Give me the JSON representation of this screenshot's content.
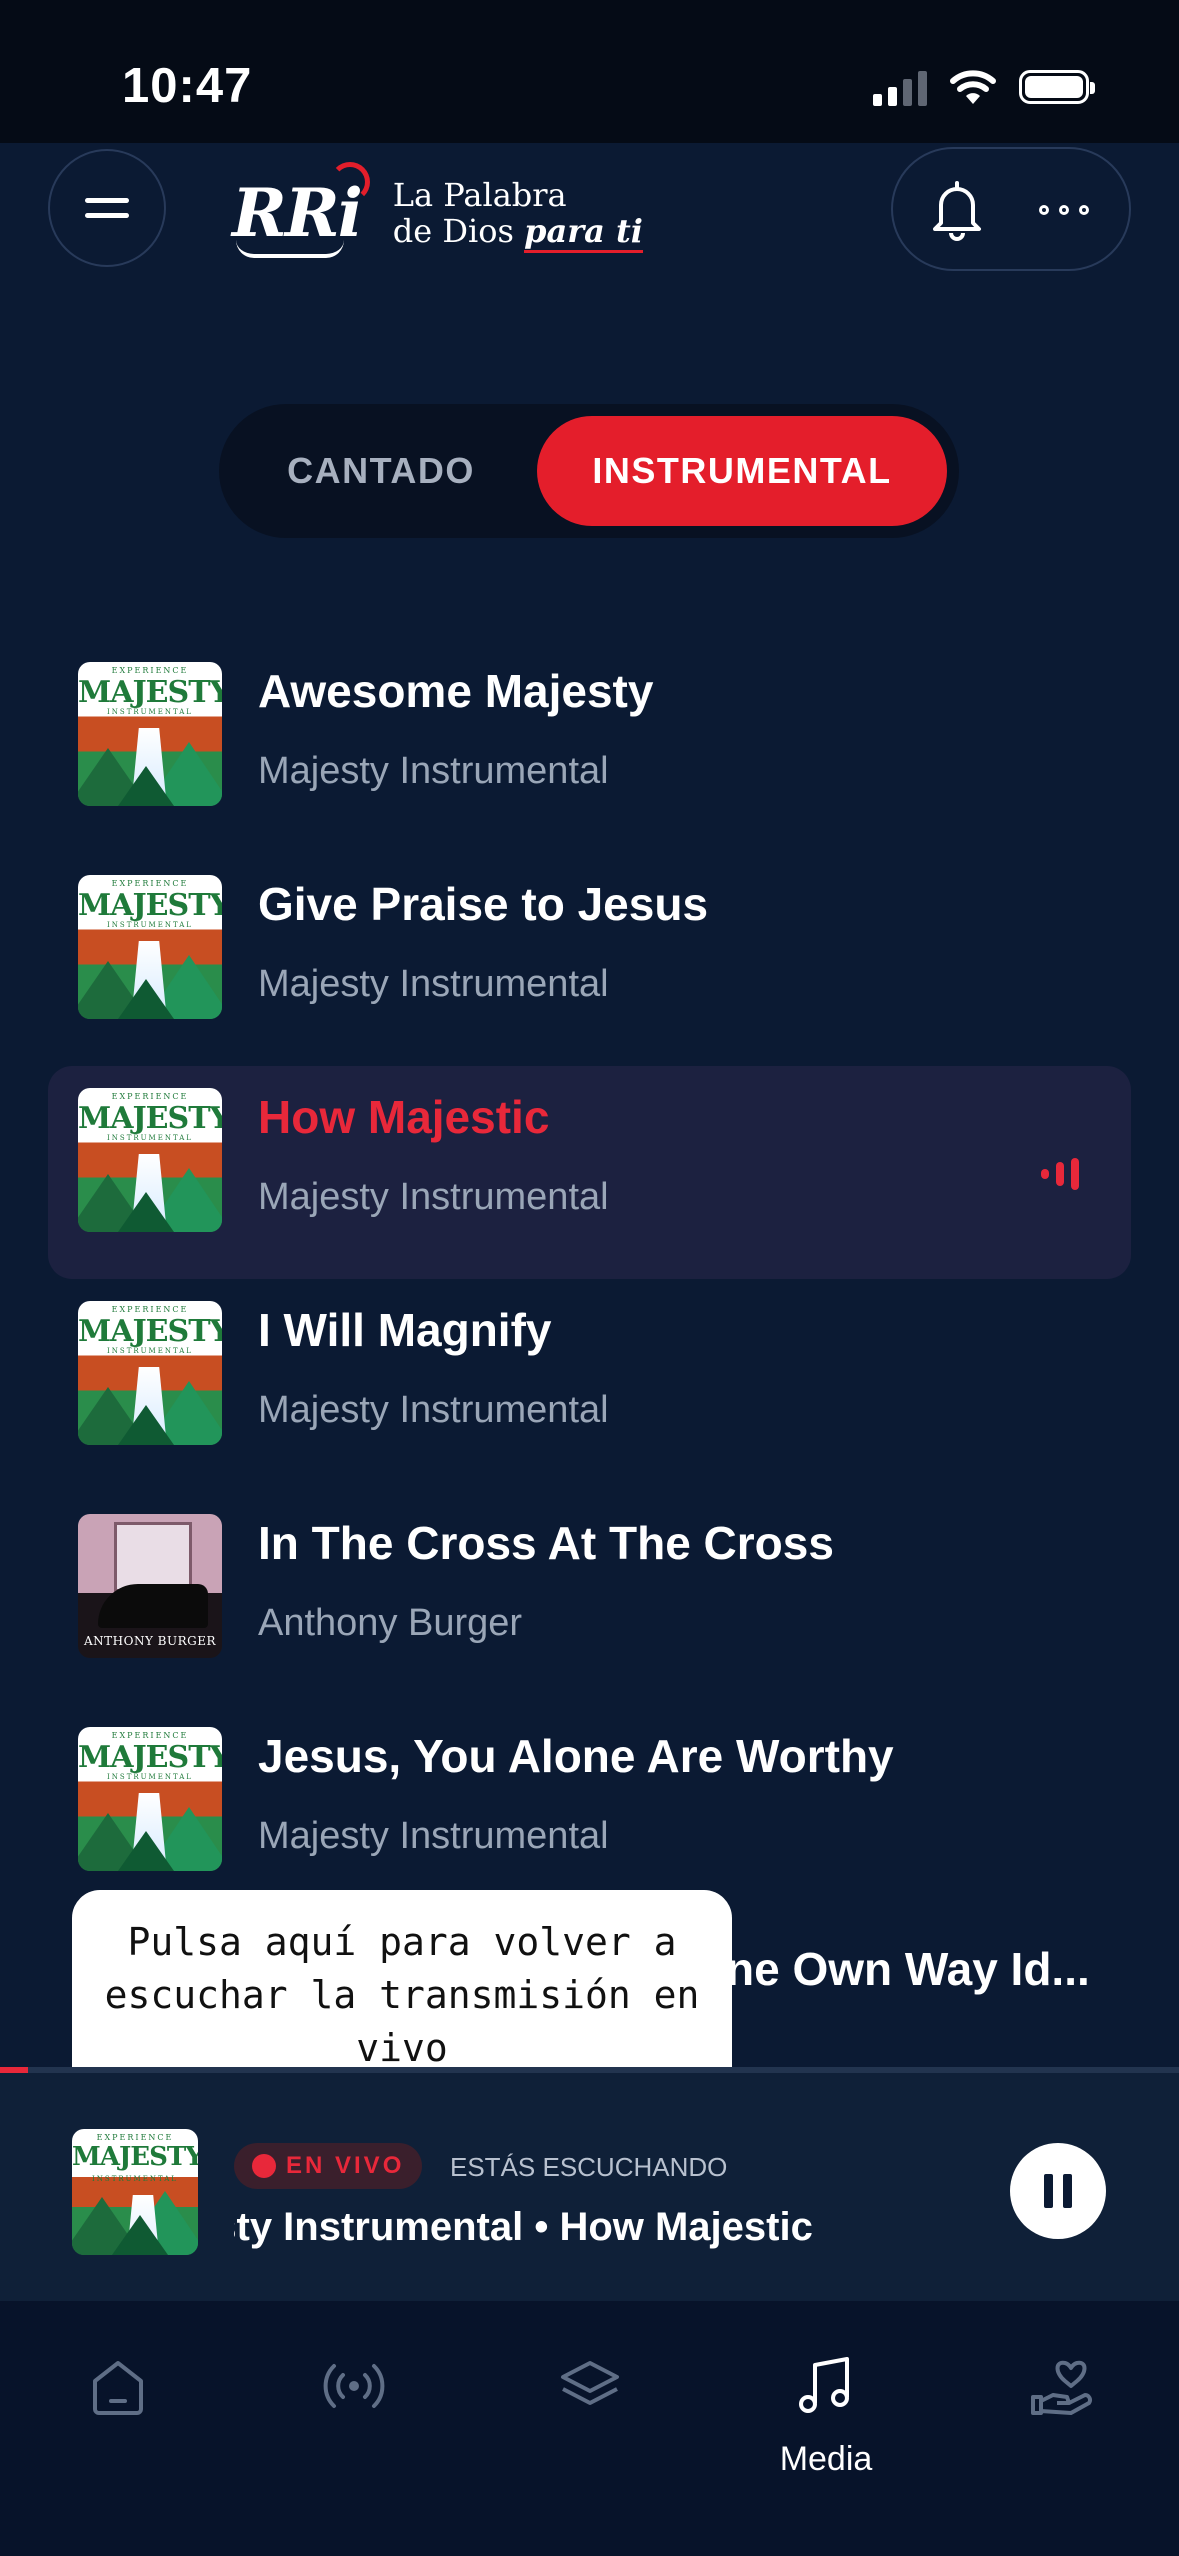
{
  "status_bar": {
    "time": "10:47"
  },
  "header": {
    "logo_mark": "RRi",
    "tagline_line1": "La Palabra",
    "tagline_line2_prefix": "de Dios ",
    "tagline_line2_emphasis": "para ti"
  },
  "segment": {
    "options": [
      {
        "label": "CANTADO",
        "selected": false
      },
      {
        "label": "INSTRUMENTAL",
        "selected": true
      }
    ]
  },
  "tracks": [
    {
      "title": "Awesome Majesty",
      "artist": "Majesty Instrumental",
      "art": "majesty",
      "playing": false
    },
    {
      "title": "Give Praise to Jesus",
      "artist": "Majesty Instrumental",
      "art": "majesty",
      "playing": false
    },
    {
      "title": "How Majestic",
      "artist": "Majesty Instrumental",
      "art": "majesty",
      "playing": true
    },
    {
      "title": "I Will Magnify",
      "artist": "Majesty Instrumental",
      "art": "majesty",
      "playing": false
    },
    {
      "title": "In The Cross At The Cross",
      "artist": "Anthony Burger",
      "art": "burger",
      "playing": false
    },
    {
      "title": "Jesus, You Alone Are Worthy",
      "artist": "Majesty Instrumental",
      "art": "majesty",
      "playing": false
    },
    {
      "title": "ne Own Way Id...",
      "artist": "",
      "art": "none",
      "playing": false
    }
  ],
  "album_art": {
    "majesty": {
      "top": "EXPERIENCE",
      "main": "MAJESTY",
      "sub": "INSTRUMENTAL"
    },
    "burger": {
      "name": "ANTHONY BURGER"
    }
  },
  "tooltip": {
    "text": "Pulsa aquí para volver a escuchar la transmisión en vivo"
  },
  "mini_player": {
    "live_label": "EN VIVO",
    "listening_label": "ESTÁS ESCUCHANDO",
    "now_playing": "esty Instrumental • How Majestic"
  },
  "bottom_nav": {
    "items": [
      {
        "icon": "home-icon",
        "label": "",
        "active": false
      },
      {
        "icon": "live-radio-icon",
        "label": "",
        "active": false
      },
      {
        "icon": "layers-icon",
        "label": "",
        "active": false
      },
      {
        "icon": "music-note-icon",
        "label": "Media",
        "active": true
      },
      {
        "icon": "heart-hand-icon",
        "label": "",
        "active": false
      }
    ]
  },
  "colors": {
    "background": "#0b1a33",
    "accent_red": "#e41e2b",
    "secondary_text": "#9aa6b7"
  }
}
